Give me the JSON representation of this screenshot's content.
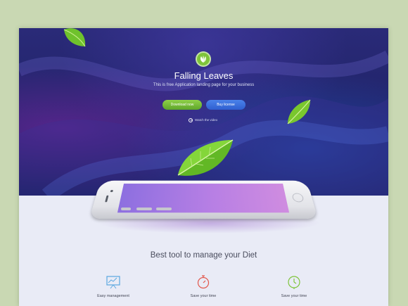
{
  "hero": {
    "title": "Falling Leaves",
    "subtitle": "This is free Application landing page for your business",
    "download_label": "Download now",
    "license_label": "Buy license",
    "watch_label": "Watch the video"
  },
  "features": {
    "heading": "Best tool to manage your Diet",
    "items": [
      {
        "label": "Easy management",
        "icon": "presentation-board-icon",
        "color": "#5aa7e0"
      },
      {
        "label": "Save your time",
        "icon": "stopwatch-icon",
        "color": "#e2574c"
      },
      {
        "label": "Save your time",
        "icon": "clock-icon",
        "color": "#7ec43a"
      }
    ]
  },
  "colors": {
    "background": "#c9d8b3",
    "hero": "#22246a",
    "accent_green": "#7ec43a",
    "accent_blue": "#3a6fdc",
    "screen": "#b07ee4"
  }
}
